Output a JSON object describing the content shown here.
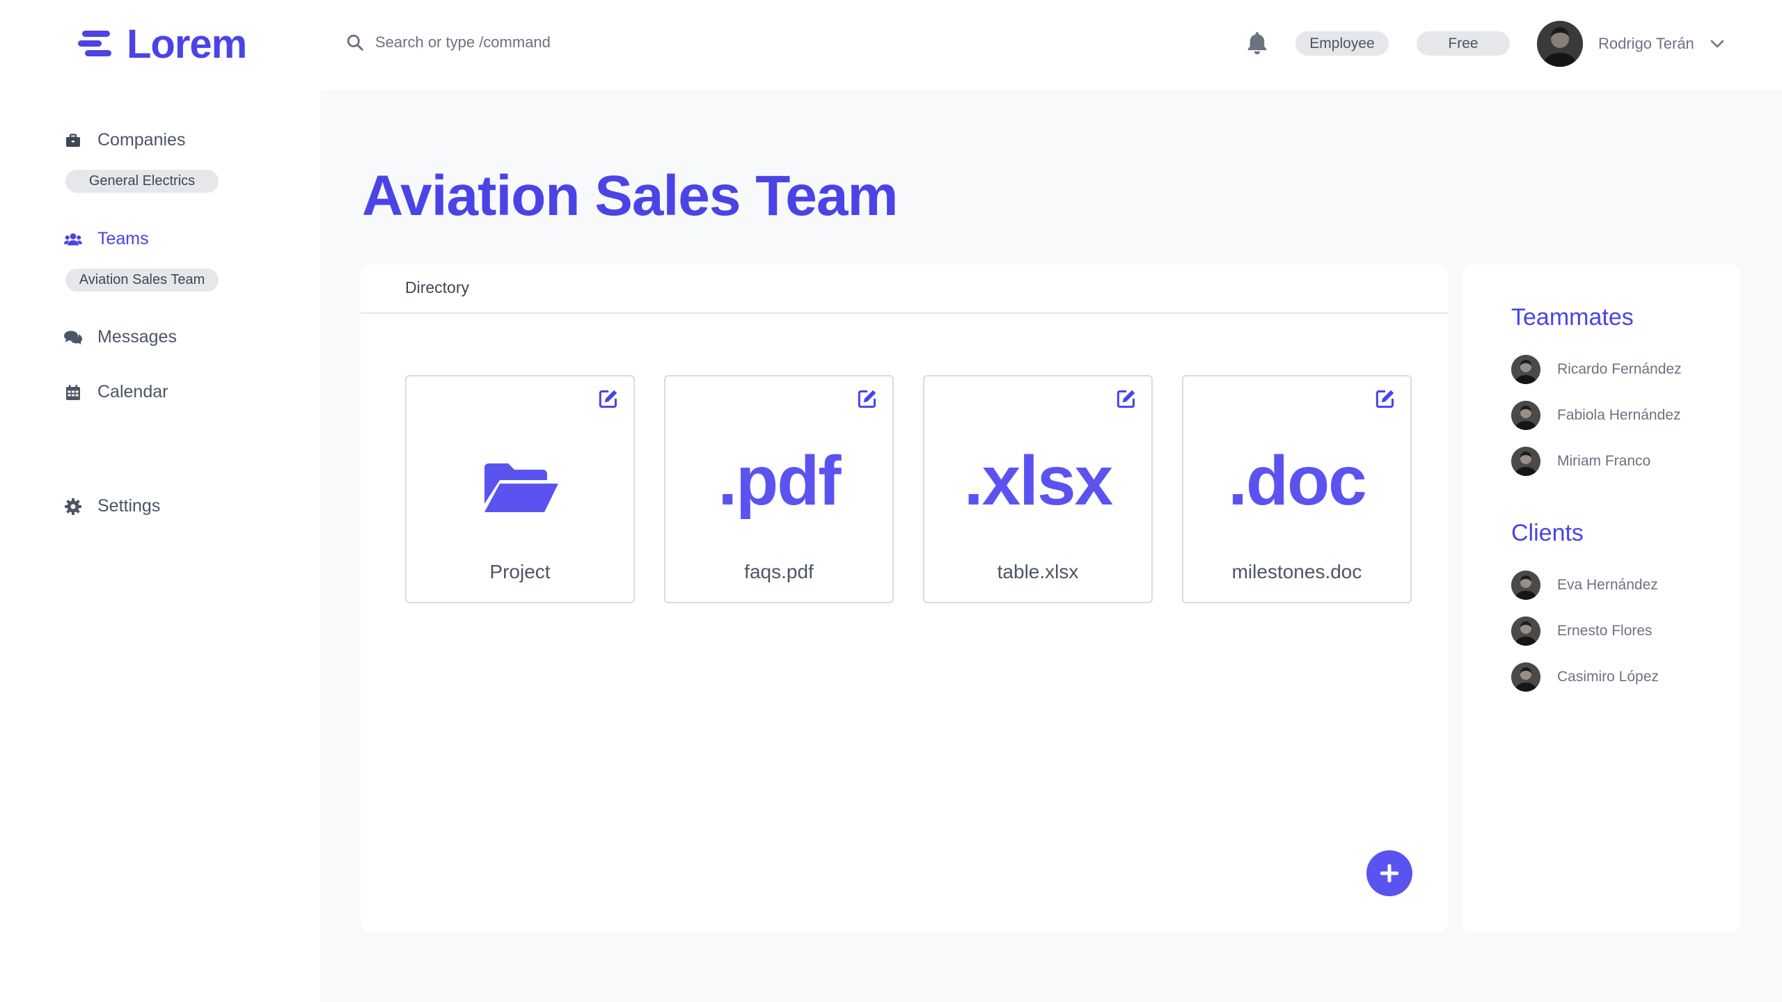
{
  "app": {
    "name": "Lorem",
    "accent": "#4a44e6"
  },
  "header": {
    "search_placeholder": "Search or type /command",
    "role_badge": "Employee",
    "plan_badge": "Free",
    "user_name": "Rodrigo Terán"
  },
  "sidebar": {
    "companies": {
      "label": "Companies",
      "selected": "General Electrics"
    },
    "teams": {
      "label": "Teams",
      "selected": "Aviation Sales Team"
    },
    "messages": {
      "label": "Messages"
    },
    "calendar": {
      "label": "Calendar"
    },
    "settings": {
      "label": "Settings"
    }
  },
  "main": {
    "title": "Aviation Sales Team",
    "tab": "Directory",
    "files": [
      {
        "ext": "",
        "icon": "folder-open-icon",
        "name": "Project"
      },
      {
        "ext": ".pdf",
        "name": "faqs.pdf"
      },
      {
        "ext": ".xlsx",
        "name": "table.xlsx"
      },
      {
        "ext": ".doc",
        "name": "milestones.doc"
      }
    ]
  },
  "aside": {
    "teammates_title": "Teammates",
    "teammates": [
      "Ricardo Fernández",
      "Fabiola Hernández",
      "Miriam Franco"
    ],
    "clients_title": "Clients",
    "clients": [
      "Eva Hernández",
      "Ernesto Flores",
      "Casimiro López"
    ]
  }
}
